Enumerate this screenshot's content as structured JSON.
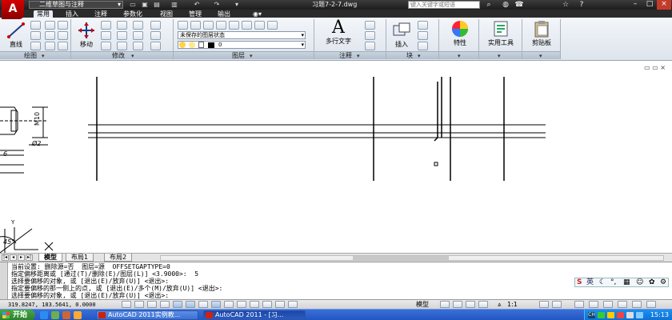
{
  "titlebar": {
    "app_logo": "A",
    "workspace": "二维草图与注释",
    "document_title": "习题7-2-7.dwg",
    "search_placeholder": "键入关键字或短语"
  },
  "tabs": [
    "常用",
    "插入",
    "注释",
    "参数化",
    "视图",
    "管理",
    "输出"
  ],
  "ribbon": {
    "draw": {
      "line_label": "直线",
      "title": "绘图"
    },
    "modify": {
      "move_label": "移动",
      "title": "修改"
    },
    "layers": {
      "state_value": "未保存的图层状态",
      "current_layer": "0",
      "title": "图层"
    },
    "annotation": {
      "mtext_label": "多行文字",
      "mtext_glyph": "A",
      "title": "注释"
    },
    "block": {
      "insert_label": "插入",
      "title": "块"
    },
    "properties": {
      "label": "特性"
    },
    "utilities": {
      "label": "实用工具"
    },
    "clipboard": {
      "label": "剪贴板"
    }
  },
  "drawing": {
    "dim_m10": "M10",
    "dim_phi2": "Ø2",
    "dim_6": "6",
    "dim_45": "45°",
    "ucs_y": "Y"
  },
  "layout_tabs": [
    "模型",
    "布局1",
    "布局2"
  ],
  "command_lines": [
    "当前设置: 删除源=否  图层=源  OFFSETGAPTYPE=0",
    "指定偏移距离或 [通过(T)/删除(E)/图层(L)] <3.9000>:  5",
    "选择要偏移的对象, 或 [退出(E)/放弃(U)] <退出>:",
    "指定要偏移的那一侧上的点, 或 [退出(E)/多个(M)/放弃(U)] <退出>:",
    "选择要偏移的对象, 或 [退出(E)/放弃(U)] <退出>:"
  ],
  "ime": {
    "lang": "英"
  },
  "statusbar": {
    "coords": "319.8247, 183.5641, 0.0000",
    "model_label": "模型",
    "scale": "1:1"
  },
  "taskbar": {
    "start_label": "开始",
    "tasks": [
      "AutoCAD 2011实例教...",
      "AutoCAD 2011 - [习..."
    ],
    "clock": "15:13",
    "lang": "CH"
  }
}
